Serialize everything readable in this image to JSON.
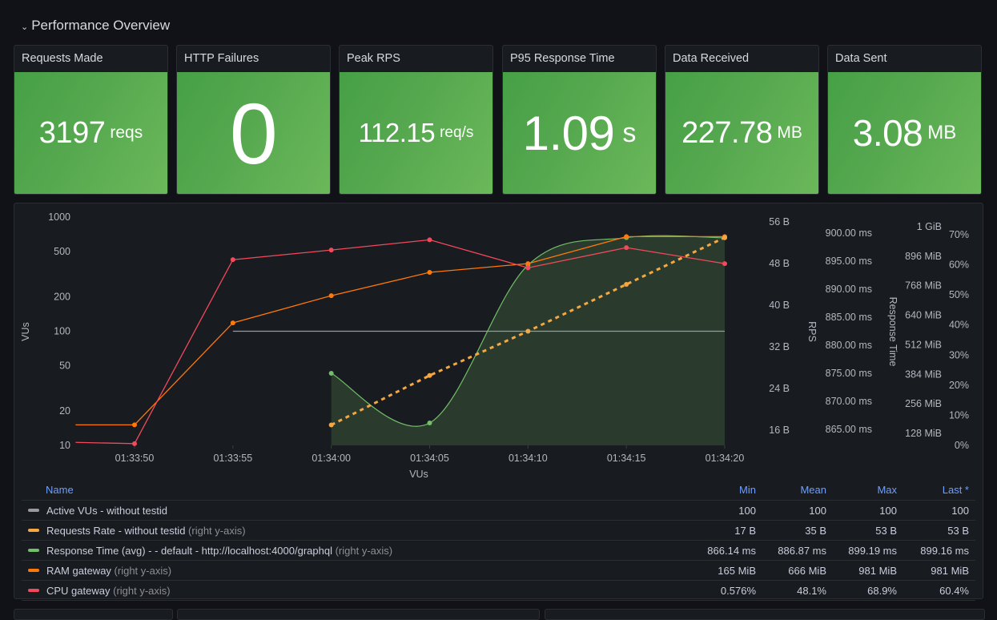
{
  "row": {
    "title": "Performance Overview",
    "chevron_icon": "chevron-down-icon"
  },
  "stats": [
    {
      "title": "Requests Made",
      "value": "3197",
      "unit": "reqs"
    },
    {
      "title": "HTTP Failures",
      "value": "0",
      "unit": ""
    },
    {
      "title": "Peak RPS",
      "value": "112.15",
      "unit": "req/s"
    },
    {
      "title": "P95 Response Time",
      "value": "1.09",
      "unit": "s"
    },
    {
      "title": "Data Received",
      "value": "227.78",
      "unit": "MB"
    },
    {
      "title": "Data Sent",
      "value": "3.08",
      "unit": "MB"
    }
  ],
  "colors": {
    "stat_green": "#56a84f",
    "active_vus": "#9a9a9e",
    "requests_rate": "#f5a742",
    "response_time": "#73bf69",
    "ram": "#ff780a",
    "cpu": "#f2495c",
    "legend_header": "#6e9fff"
  },
  "chart_data": {
    "type": "line",
    "title": "",
    "xlabel": "VUs",
    "x": [
      "01:33:47",
      "01:33:50",
      "01:33:55",
      "01:34:00",
      "01:34:05",
      "01:34:10",
      "01:34:15",
      "01:34:20"
    ],
    "x_ticks": [
      "01:33:50",
      "01:33:55",
      "01:34:00",
      "01:34:05",
      "01:34:10",
      "01:34:15",
      "01:34:20"
    ],
    "axes": {
      "vus": {
        "label": "VUs",
        "side": "left",
        "scale": "log",
        "range": [
          10,
          1000
        ],
        "ticks": [
          1000,
          500,
          200,
          100,
          50,
          20,
          10
        ],
        "tick_labels": [
          "1000",
          "500",
          "200",
          "100",
          "50",
          "20",
          "10"
        ]
      },
      "rps": {
        "label": "RPS",
        "side": "right",
        "range": [
          16,
          56
        ],
        "ticks": [
          56,
          48,
          40,
          32,
          24,
          16
        ],
        "tick_labels": [
          "56 B",
          "48 B",
          "40 B",
          "32 B",
          "24 B",
          "16 B"
        ]
      },
      "response_time": {
        "label": "Response Time",
        "side": "right",
        "range": [
          865,
          900
        ],
        "ticks": [
          900,
          895,
          890,
          885,
          880,
          875,
          870,
          865
        ],
        "tick_labels": [
          "900.00 ms",
          "895.00 ms",
          "890.00 ms",
          "885.00 ms",
          "880.00 ms",
          "875.00 ms",
          "870.00 ms",
          "865.00 ms"
        ]
      },
      "ram": {
        "label": "",
        "side": "right",
        "range": [
          128,
          1024
        ],
        "ticks": [
          1024,
          896,
          768,
          640,
          512,
          384,
          256,
          128
        ],
        "tick_labels": [
          "1 GiB",
          "896 MiB",
          "768 MiB",
          "640 MiB",
          "512 MiB",
          "384 MiB",
          "256 MiB",
          "128 MiB"
        ]
      },
      "cpu": {
        "label": "",
        "side": "right",
        "range": [
          0,
          70
        ],
        "ticks": [
          70,
          60,
          50,
          40,
          30,
          20,
          10,
          0
        ],
        "tick_labels": [
          "70%",
          "60%",
          "50%",
          "40%",
          "30%",
          "20%",
          "10%",
          "0%"
        ]
      }
    },
    "series": [
      {
        "name": "Active VUs - without testid",
        "axis": "vus",
        "color": "#9a9a9e",
        "style": "solid",
        "points": false,
        "values": [
          null,
          null,
          100,
          100,
          100,
          100,
          100,
          100
        ]
      },
      {
        "name": "Requests Rate - without testid",
        "axis": "rps",
        "color": "#f5a742",
        "style": "dashed",
        "points": true,
        "values": [
          null,
          null,
          null,
          17,
          26.5,
          35,
          44,
          53
        ]
      },
      {
        "name": "Response Time (avg) - - default - http://localhost:4000/graphql",
        "axis": "response_time",
        "color": "#73bf69",
        "style": "smooth-fill",
        "points": true,
        "values": [
          null,
          null,
          null,
          875,
          866.14,
          894.3,
          899.19,
          899.16
        ]
      },
      {
        "name": "RAM gateway",
        "axis": "ram",
        "color": "#ff780a",
        "style": "solid",
        "points": true,
        "values": [
          165,
          165,
          607,
          725,
          826,
          864,
          981,
          981
        ]
      },
      {
        "name": "CPU gateway",
        "axis": "cpu",
        "color": "#f2495c",
        "style": "solid",
        "points": true,
        "values": [
          1.0,
          0.576,
          61.7,
          64.9,
          68.3,
          59.0,
          65.7,
          60.4
        ]
      }
    ],
    "legend": {
      "placement": "bottom",
      "mode": "table"
    }
  },
  "legend": {
    "columns": [
      "Name",
      "Min",
      "Mean",
      "Max",
      "Last *"
    ],
    "rows": [
      {
        "name": "Active VUs - without testid",
        "hint": "",
        "color": "#9a9a9e",
        "min": "100",
        "mean": "100",
        "max": "100",
        "last": "100"
      },
      {
        "name": "Requests Rate - without testid",
        "hint": "(right y-axis)",
        "color": "#f5a742",
        "min": "17 B",
        "mean": "35 B",
        "max": "53 B",
        "last": "53 B"
      },
      {
        "name": "Response Time (avg) - - default - http://localhost:4000/graphql",
        "hint": "(right y-axis)",
        "color": "#73bf69",
        "min": "866.14 ms",
        "mean": "886.87 ms",
        "max": "899.19 ms",
        "last": "899.16 ms"
      },
      {
        "name": "RAM gateway",
        "hint": "(right y-axis)",
        "color": "#ff780a",
        "min": "165 MiB",
        "mean": "666 MiB",
        "max": "981 MiB",
        "last": "981 MiB"
      },
      {
        "name": "CPU gateway",
        "hint": "(right y-axis)",
        "color": "#f2495c",
        "min": "0.576%",
        "mean": "48.1%",
        "max": "68.9%",
        "last": "60.4%"
      }
    ]
  }
}
